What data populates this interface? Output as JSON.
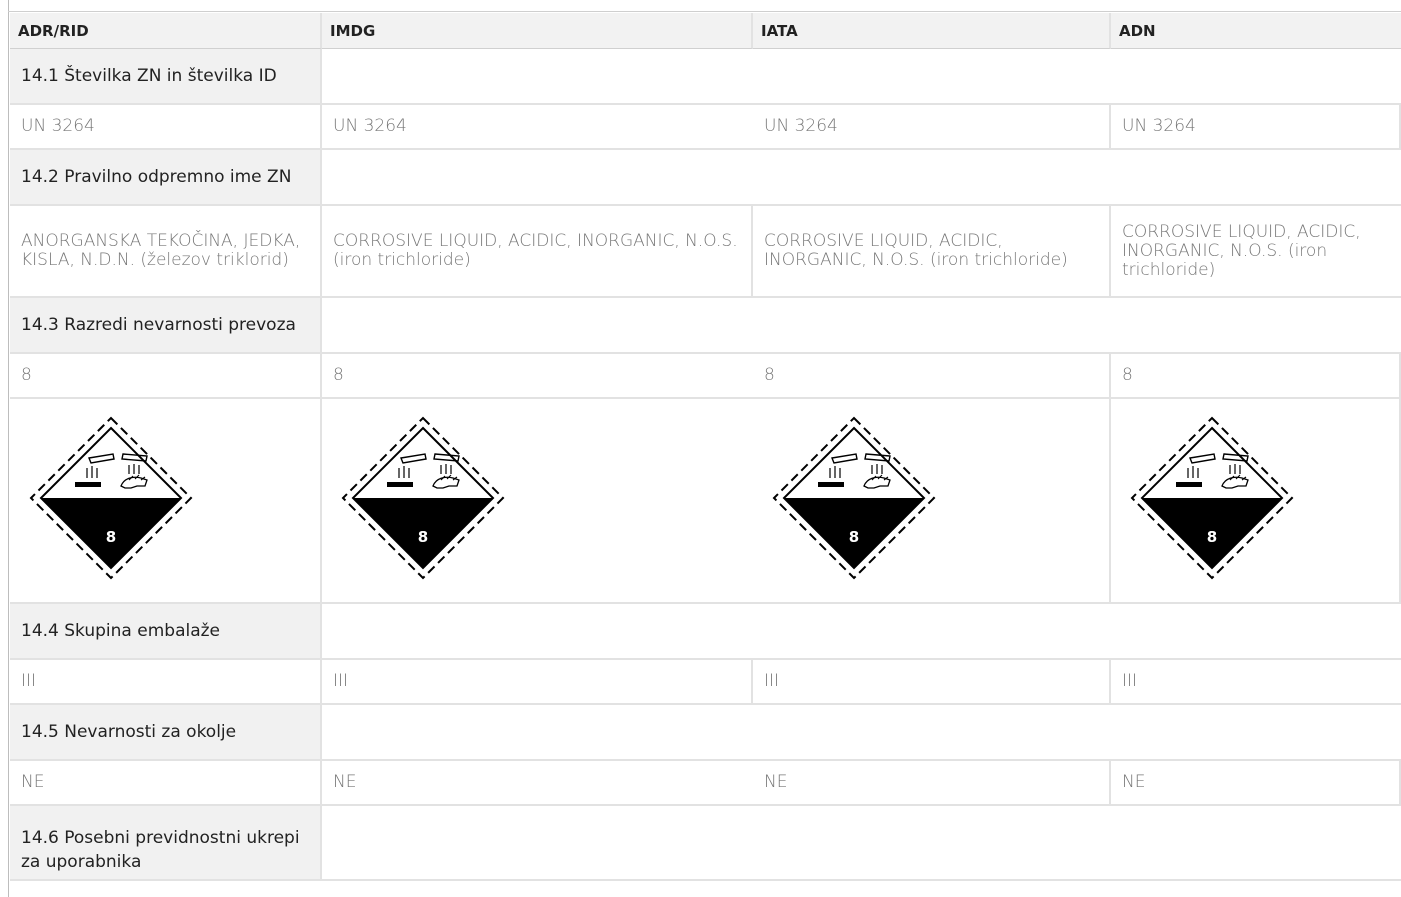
{
  "headers": [
    "ADR/RID",
    "IMDG",
    "IATA",
    "ADN"
  ],
  "sections": [
    {
      "title": "14.1 Številka ZN in številka ID",
      "values": [
        "UN 3264",
        "UN 3264",
        "UN 3264",
        "UN 3264"
      ]
    },
    {
      "title": "14.2 Pravilno odpremno ime ZN",
      "values": [
        "ANORGANSKA TEKOČINA, JEDKA, KISLA, N.D.N. (železov triklorid)",
        "CORROSIVE LIQUID, ACIDIC, INORGANIC, N.O.S. (iron trichloride)",
        "CORROSIVE LIQUID, ACIDIC, INORGANIC, N.O.S. (iron trichloride)",
        "CORROSIVE LIQUID, ACIDIC, INORGANIC, N.O.S. (iron trichloride)"
      ]
    },
    {
      "title": "14.3 Razredi nevarnosti prevoza",
      "values": [
        "8",
        "8",
        "8",
        "8"
      ]
    },
    {
      "title": "14.4 Skupina embalaže",
      "values": [
        "III",
        "III",
        "III",
        "III"
      ]
    },
    {
      "title": "14.5 Nevarnosti za okolje",
      "values": [
        "NE",
        "NE",
        "NE",
        "NE"
      ]
    },
    {
      "title": "14.6 Posebni previdnostni ukrepi za uporabnika",
      "values": []
    }
  ],
  "hazard_label": {
    "class_number": "8",
    "icon": "corrosive-class-8-diamond-icon",
    "colors": {
      "top": "#ffffff",
      "bottom": "#000000",
      "border": "#000000"
    }
  }
}
